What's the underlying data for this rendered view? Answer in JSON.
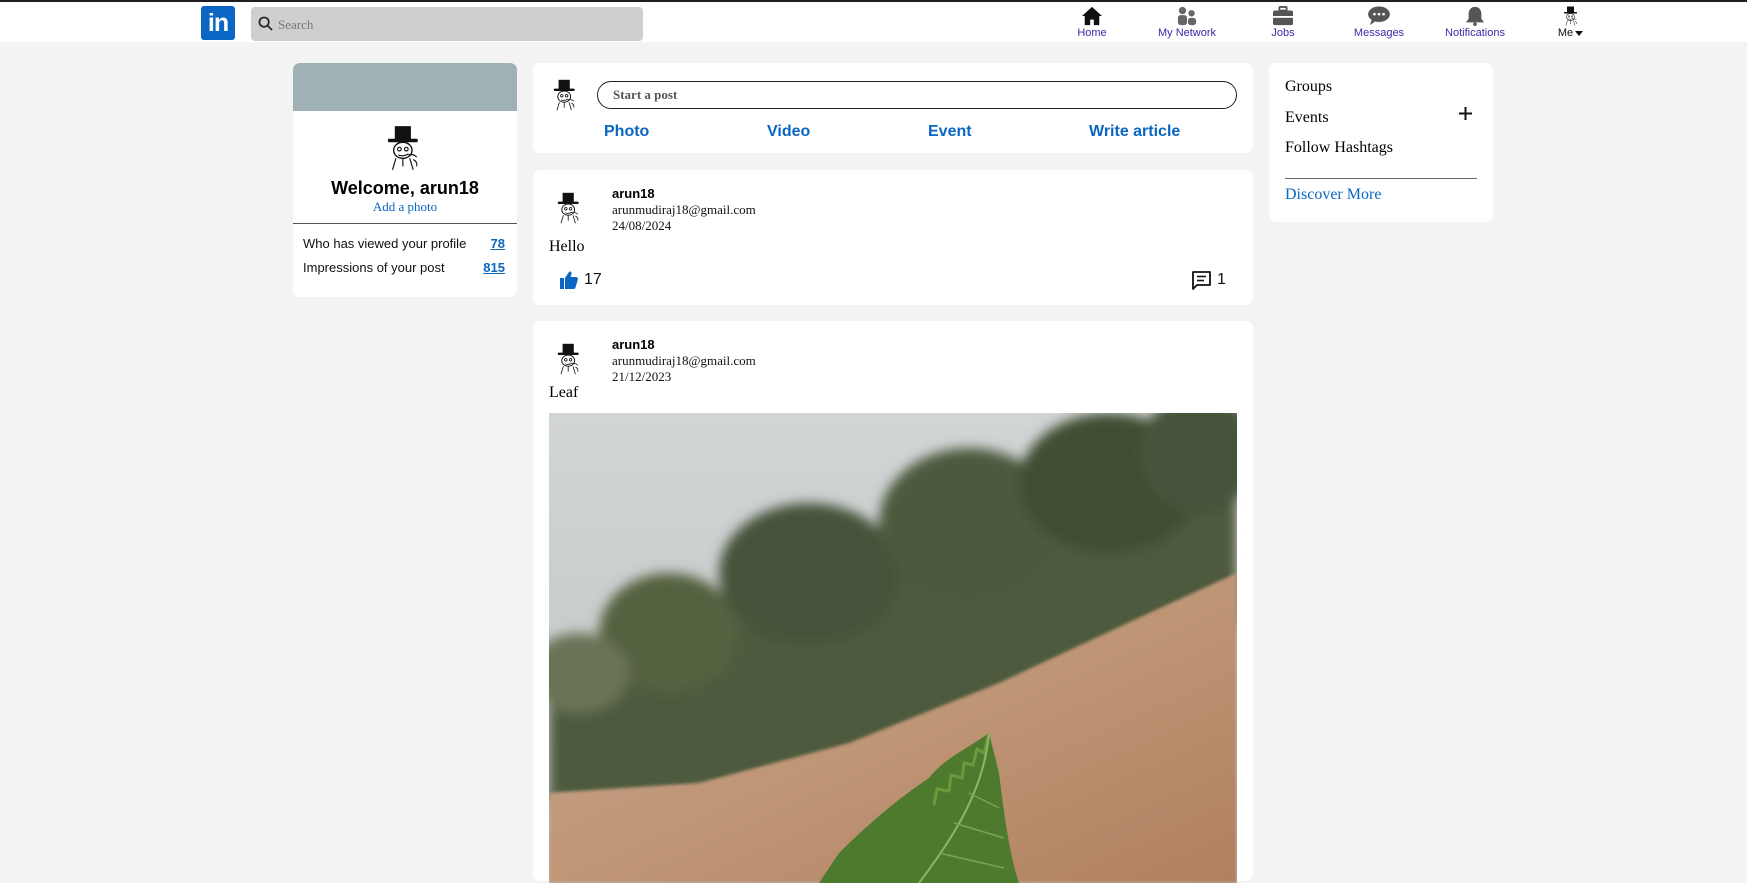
{
  "colors": {
    "brand": "#0a66c2",
    "page_bg": "#f3f3f3",
    "banner": "#a0b1b6",
    "nav_text": "#3b2aa6"
  },
  "header": {
    "logo_text": "in",
    "search_placeholder": "Search",
    "nav": [
      {
        "label": "Home",
        "icon": "home-icon"
      },
      {
        "label": "My Network",
        "icon": "network-icon"
      },
      {
        "label": "Jobs",
        "icon": "briefcase-icon"
      },
      {
        "label": "Messages",
        "icon": "messages-icon"
      },
      {
        "label": "Notifications",
        "icon": "bell-icon"
      },
      {
        "label": "Me",
        "icon": "avatar"
      }
    ]
  },
  "profile": {
    "welcome": "Welcome, arun18",
    "add_photo": "Add a photo",
    "stats": [
      {
        "label": "Who has viewed your profile",
        "value": "78"
      },
      {
        "label": "Impressions of your post",
        "value": "815"
      }
    ]
  },
  "composer": {
    "placeholder": "Start a post",
    "actions": [
      "Photo",
      "Video",
      "Event",
      "Write article"
    ]
  },
  "posts": [
    {
      "author": "arun18",
      "email": "arunmudiraj18@gmail.com",
      "date": "24/08/2024",
      "text": "Hello",
      "likes": "17",
      "comments": "1"
    },
    {
      "author": "arun18",
      "email": "arunmudiraj18@gmail.com",
      "date": "21/12/2023",
      "text": "Leaf",
      "image": "leaf-photo"
    }
  ],
  "sidebar": {
    "items": [
      "Groups",
      "Events",
      "Follow Hashtags"
    ],
    "discover": "Discover More"
  }
}
